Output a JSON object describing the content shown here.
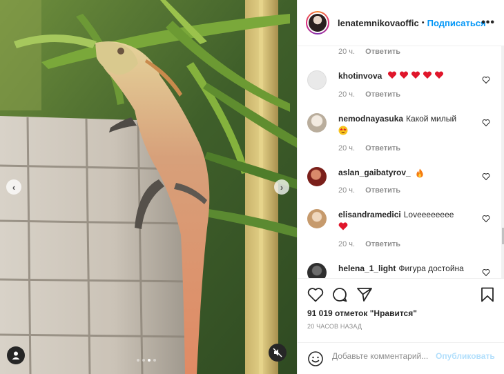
{
  "post": {
    "author": "lenatemnikovaoffic",
    "separator": "•",
    "follow_label": "Подписаться",
    "more_label": "•••",
    "likes_text": "91 019 отметок \"Нравится\"",
    "posted_ago": "20 ЧАСОВ НАЗАД"
  },
  "media": {
    "prev_label": "‹",
    "next_label": "›",
    "slide_count": 4,
    "active_slide": 3,
    "icons": {
      "user_tag": "user-silhouette-icon",
      "mute": "speaker-muted-icon"
    }
  },
  "comments_top_meta": {
    "time": "20 ч.",
    "reply": "Ответить"
  },
  "comments": [
    {
      "username": "khotinvova",
      "text": "",
      "emoji": "heart x5",
      "time": "20 ч.",
      "reply": "Ответить",
      "avatar_color": "#e9e9e9"
    },
    {
      "username": "nemodnayasuka",
      "text": "Какой милый",
      "emoji": "star-struck",
      "time": "20 ч.",
      "reply": "Ответить",
      "avatar_color": "#cfc8bf"
    },
    {
      "username": "aslan_gaibatyrov_",
      "text": "",
      "emoji": "fire",
      "time": "20 ч.",
      "reply": "Ответить",
      "avatar_color": "#8a2a22"
    },
    {
      "username": "elisandramedici",
      "text": "Loveeeeeeee",
      "emoji": "heart",
      "time": "20 ч.",
      "reply": "Ответить",
      "avatar_color": "#d8b896"
    },
    {
      "username": "helena_1_light",
      "text": "Фигура достойна",
      "emoji": "",
      "time": "",
      "reply": "",
      "avatar_color": "#3a3a3a"
    }
  ],
  "add_comment": {
    "placeholder": "Добавьте комментарий...",
    "publish_label": "Опубликовать"
  },
  "colors": {
    "accent": "#0095f6",
    "publish_disabled": "#b2dffc",
    "heart_emoji": "#e0162b",
    "muted_text": "#8e8e8e"
  }
}
